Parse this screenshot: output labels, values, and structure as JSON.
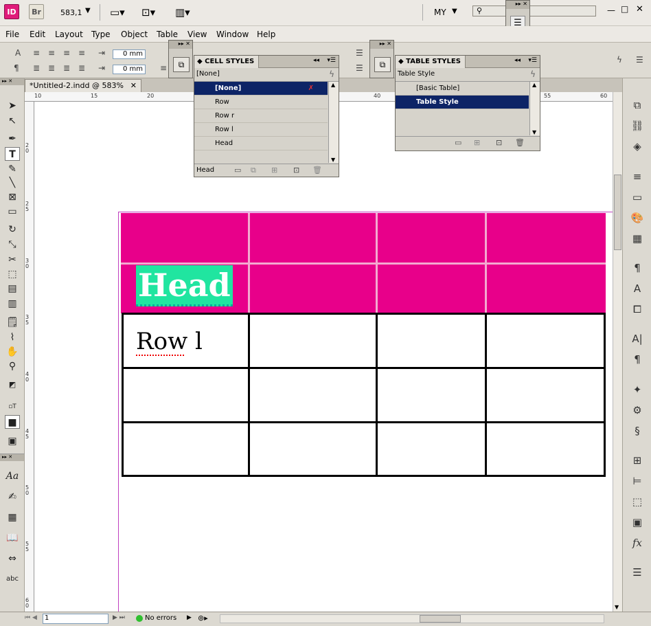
{
  "app": {
    "logo_id": "ID",
    "logo_br": "Br",
    "zoom": "583,1",
    "workspace": "MY"
  },
  "menu": [
    "File",
    "Edit",
    "Layout",
    "Type",
    "Object",
    "Table",
    "View",
    "Window",
    "Help"
  ],
  "control": {
    "indent_top": "0 mm",
    "indent_bottom": "0 mm"
  },
  "document": {
    "tab_title": "*Untitled-2.indd @ 583%",
    "ruler_h": [
      "10",
      "15",
      "20",
      "40",
      "55",
      "60"
    ],
    "ruler_v": [
      "2\n0",
      "2\n5",
      "3\n0",
      "3\n5",
      "4\n0",
      "4\n5",
      "5\n0",
      "5\n5",
      "6\n0"
    ]
  },
  "table": {
    "head_text": "Head",
    "row_text": "Row l",
    "head_color": "#e8008a",
    "highlight_color": "#20e5a0"
  },
  "cell_styles": {
    "title": "CELL STYLES",
    "current": "[None]",
    "items": [
      "[None]",
      "Row",
      "Row r",
      "Row l",
      "Head"
    ],
    "selected": "[None]",
    "footer_label": "Head"
  },
  "table_styles": {
    "title": "TABLE STYLES",
    "current": "Table Style",
    "items": [
      "[Basic Table]",
      "Table Style"
    ],
    "selected": "Table Style"
  },
  "status": {
    "page": "1",
    "errors": "No errors"
  },
  "colors": {
    "accent_selection": "#0d2466",
    "pink": "#e8008a",
    "teal_highlight": "#20e5a0"
  }
}
